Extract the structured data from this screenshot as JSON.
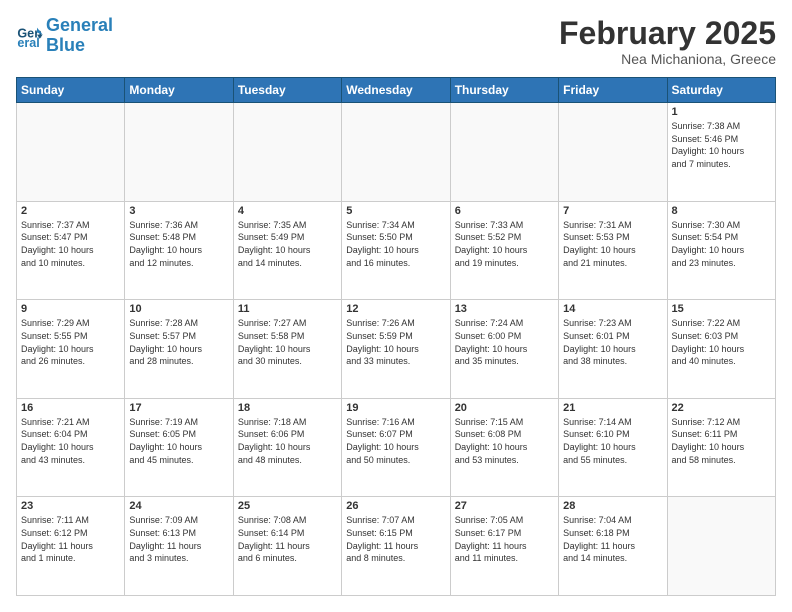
{
  "header": {
    "logo_line1": "General",
    "logo_line2": "Blue",
    "month": "February 2025",
    "location": "Nea Michaniona, Greece"
  },
  "weekdays": [
    "Sunday",
    "Monday",
    "Tuesday",
    "Wednesday",
    "Thursday",
    "Friday",
    "Saturday"
  ],
  "weeks": [
    [
      {
        "day": "",
        "info": ""
      },
      {
        "day": "",
        "info": ""
      },
      {
        "day": "",
        "info": ""
      },
      {
        "day": "",
        "info": ""
      },
      {
        "day": "",
        "info": ""
      },
      {
        "day": "",
        "info": ""
      },
      {
        "day": "1",
        "info": "Sunrise: 7:38 AM\nSunset: 5:46 PM\nDaylight: 10 hours\nand 7 minutes."
      }
    ],
    [
      {
        "day": "2",
        "info": "Sunrise: 7:37 AM\nSunset: 5:47 PM\nDaylight: 10 hours\nand 10 minutes."
      },
      {
        "day": "3",
        "info": "Sunrise: 7:36 AM\nSunset: 5:48 PM\nDaylight: 10 hours\nand 12 minutes."
      },
      {
        "day": "4",
        "info": "Sunrise: 7:35 AM\nSunset: 5:49 PM\nDaylight: 10 hours\nand 14 minutes."
      },
      {
        "day": "5",
        "info": "Sunrise: 7:34 AM\nSunset: 5:50 PM\nDaylight: 10 hours\nand 16 minutes."
      },
      {
        "day": "6",
        "info": "Sunrise: 7:33 AM\nSunset: 5:52 PM\nDaylight: 10 hours\nand 19 minutes."
      },
      {
        "day": "7",
        "info": "Sunrise: 7:31 AM\nSunset: 5:53 PM\nDaylight: 10 hours\nand 21 minutes."
      },
      {
        "day": "8",
        "info": "Sunrise: 7:30 AM\nSunset: 5:54 PM\nDaylight: 10 hours\nand 23 minutes."
      }
    ],
    [
      {
        "day": "9",
        "info": "Sunrise: 7:29 AM\nSunset: 5:55 PM\nDaylight: 10 hours\nand 26 minutes."
      },
      {
        "day": "10",
        "info": "Sunrise: 7:28 AM\nSunset: 5:57 PM\nDaylight: 10 hours\nand 28 minutes."
      },
      {
        "day": "11",
        "info": "Sunrise: 7:27 AM\nSunset: 5:58 PM\nDaylight: 10 hours\nand 30 minutes."
      },
      {
        "day": "12",
        "info": "Sunrise: 7:26 AM\nSunset: 5:59 PM\nDaylight: 10 hours\nand 33 minutes."
      },
      {
        "day": "13",
        "info": "Sunrise: 7:24 AM\nSunset: 6:00 PM\nDaylight: 10 hours\nand 35 minutes."
      },
      {
        "day": "14",
        "info": "Sunrise: 7:23 AM\nSunset: 6:01 PM\nDaylight: 10 hours\nand 38 minutes."
      },
      {
        "day": "15",
        "info": "Sunrise: 7:22 AM\nSunset: 6:03 PM\nDaylight: 10 hours\nand 40 minutes."
      }
    ],
    [
      {
        "day": "16",
        "info": "Sunrise: 7:21 AM\nSunset: 6:04 PM\nDaylight: 10 hours\nand 43 minutes."
      },
      {
        "day": "17",
        "info": "Sunrise: 7:19 AM\nSunset: 6:05 PM\nDaylight: 10 hours\nand 45 minutes."
      },
      {
        "day": "18",
        "info": "Sunrise: 7:18 AM\nSunset: 6:06 PM\nDaylight: 10 hours\nand 48 minutes."
      },
      {
        "day": "19",
        "info": "Sunrise: 7:16 AM\nSunset: 6:07 PM\nDaylight: 10 hours\nand 50 minutes."
      },
      {
        "day": "20",
        "info": "Sunrise: 7:15 AM\nSunset: 6:08 PM\nDaylight: 10 hours\nand 53 minutes."
      },
      {
        "day": "21",
        "info": "Sunrise: 7:14 AM\nSunset: 6:10 PM\nDaylight: 10 hours\nand 55 minutes."
      },
      {
        "day": "22",
        "info": "Sunrise: 7:12 AM\nSunset: 6:11 PM\nDaylight: 10 hours\nand 58 minutes."
      }
    ],
    [
      {
        "day": "23",
        "info": "Sunrise: 7:11 AM\nSunset: 6:12 PM\nDaylight: 11 hours\nand 1 minute."
      },
      {
        "day": "24",
        "info": "Sunrise: 7:09 AM\nSunset: 6:13 PM\nDaylight: 11 hours\nand 3 minutes."
      },
      {
        "day": "25",
        "info": "Sunrise: 7:08 AM\nSunset: 6:14 PM\nDaylight: 11 hours\nand 6 minutes."
      },
      {
        "day": "26",
        "info": "Sunrise: 7:07 AM\nSunset: 6:15 PM\nDaylight: 11 hours\nand 8 minutes."
      },
      {
        "day": "27",
        "info": "Sunrise: 7:05 AM\nSunset: 6:17 PM\nDaylight: 11 hours\nand 11 minutes."
      },
      {
        "day": "28",
        "info": "Sunrise: 7:04 AM\nSunset: 6:18 PM\nDaylight: 11 hours\nand 14 minutes."
      },
      {
        "day": "",
        "info": ""
      }
    ]
  ]
}
